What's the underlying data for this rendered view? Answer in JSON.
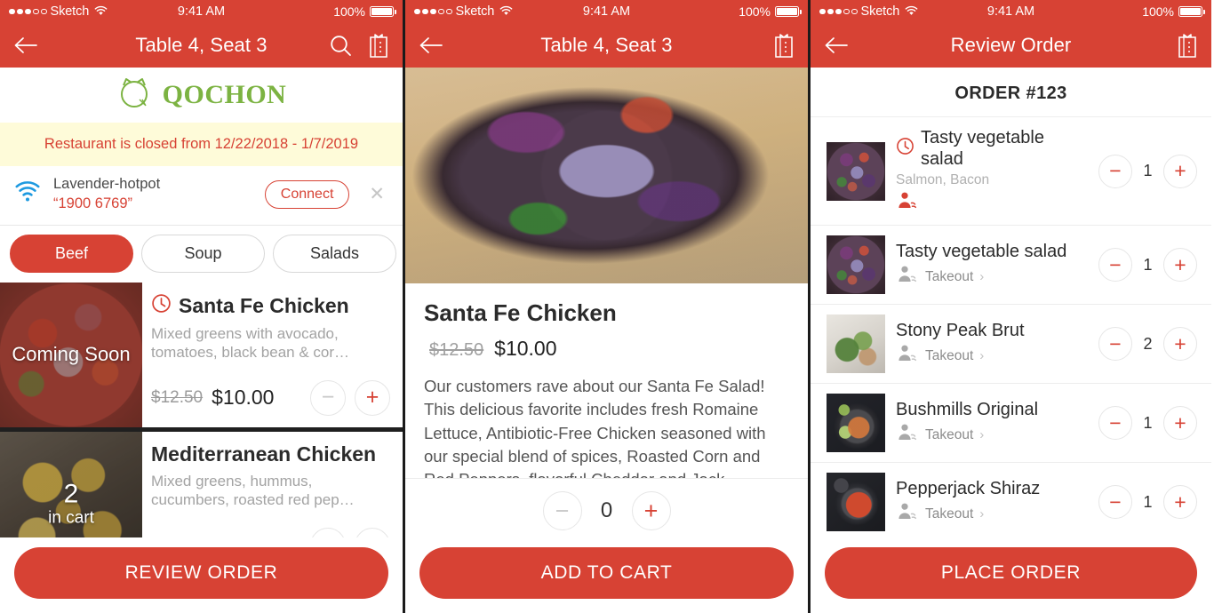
{
  "theme": {
    "red": "#d74234",
    "green": "#7cb342",
    "blue": "#1e9ae0",
    "banner_yellow": "#fefbd9"
  },
  "statusbar": {
    "carrier": "Sketch",
    "time": "9:41 AM",
    "battery": "100%"
  },
  "screen1": {
    "nav": {
      "title": "Table 4, Seat 3",
      "back_icon": "back-arrow-icon",
      "search_icon": "search-icon",
      "receipt_icon": "receipt-icon"
    },
    "brand": {
      "name": "QOCHON",
      "logo_icon": "qochon-cat-logo"
    },
    "alert": "Restaurant is closed from 12/22/2018 - 1/7/2019",
    "wifi": {
      "icon": "wifi-icon",
      "network": "Lavender-hotpot",
      "password": "“1900 6769”",
      "connect_label": "Connect",
      "close_icon": "close-icon"
    },
    "categories": [
      {
        "label": "Beef",
        "active": true
      },
      {
        "label": "Soup",
        "active": false
      },
      {
        "label": "Salads",
        "active": false
      },
      {
        "label": "",
        "active": false
      }
    ],
    "menu_items": [
      {
        "name": "Santa Fe Chicken",
        "description": "Mixed greens with avocado, tomatoes, black bean & cor…",
        "price_old": "$12.50",
        "price_new": "$10.00",
        "badge": "Coming Soon",
        "clock_icon": "clock-icon",
        "qty_minus": "−",
        "qty_plus": "+"
      },
      {
        "name": "Mediterranean Chicken",
        "description": "Mixed greens, hummus, cucumbers, roasted red pep…",
        "price_old": "",
        "price_new": "",
        "badge_count": "2",
        "badge_sub": "in cart",
        "qty_minus": "−",
        "qty_plus": "+"
      }
    ],
    "cta": "REVIEW ORDER"
  },
  "screen2": {
    "nav": {
      "title": "Table 4, Seat 3",
      "back_icon": "back-arrow-icon",
      "receipt_icon": "receipt-icon"
    },
    "detail": {
      "title": "Santa Fe Chicken",
      "price_old": "$12.50",
      "price_new": "$10.00",
      "description": "Our customers rave about our Santa Fe Salad! This delicious favorite includes fresh Romaine Lettuce, Antibiotic-Free Chicken seasoned with our special blend of spices, Roasted Corn and Red Peppers, flavorful Cheddar and Jack Cheeses and Tortilla"
    },
    "quantity": "0",
    "qty_minus": "−",
    "qty_plus": "+",
    "cta": "ADD TO CART"
  },
  "screen3": {
    "nav": {
      "title": "Review Order",
      "back_icon": "back-arrow-icon",
      "receipt_icon": "receipt-icon"
    },
    "order_title": "ORDER #123",
    "rows": [
      {
        "name": "Tasty vegetable salad",
        "sub": "Salmon, Bacon",
        "meta": "",
        "qty": "1",
        "clock_icon": "clock-icon",
        "waiter_icon": "waiter-icon-active",
        "chevron": ""
      },
      {
        "name": "Tasty vegetable salad",
        "sub": "",
        "meta": "Takeout",
        "qty": "1",
        "clock_icon": "",
        "waiter_icon": "waiter-icon",
        "chevron": "›"
      },
      {
        "name": "Stony Peak Brut",
        "sub": "",
        "meta": "Takeout",
        "qty": "2",
        "clock_icon": "",
        "waiter_icon": "waiter-icon",
        "chevron": "›"
      },
      {
        "name": "Bushmills Original",
        "sub": "",
        "meta": "Takeout",
        "qty": "1",
        "clock_icon": "",
        "waiter_icon": "waiter-icon",
        "chevron": "›"
      },
      {
        "name": "Pepperjack Shiraz",
        "sub": "",
        "meta": "Takeout",
        "qty": "1",
        "clock_icon": "",
        "waiter_icon": "waiter-icon",
        "chevron": "›"
      }
    ],
    "qty_minus": "−",
    "qty_plus": "+",
    "cta": "PLACE ORDER"
  }
}
